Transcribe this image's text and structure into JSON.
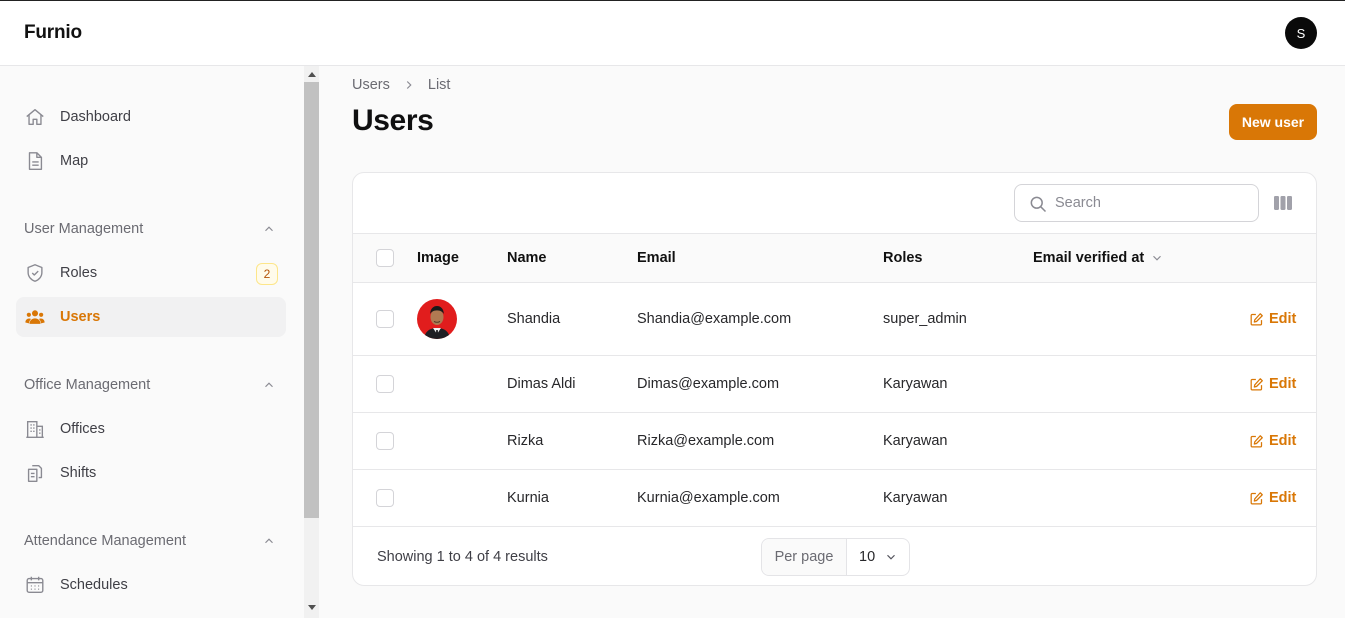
{
  "app": {
    "brand": "Furnio",
    "user_initial": "S"
  },
  "sidebar": {
    "items_top": [
      {
        "label": "Dashboard",
        "icon": "home-icon"
      },
      {
        "label": "Map",
        "icon": "document-icon"
      }
    ],
    "groups": [
      {
        "label": "User Management",
        "items": [
          {
            "label": "Roles",
            "icon": "shield-check-icon",
            "badge": "2"
          },
          {
            "label": "Users",
            "icon": "users-icon",
            "active": true
          }
        ]
      },
      {
        "label": "Office Management",
        "items": [
          {
            "label": "Offices",
            "icon": "building-icon"
          },
          {
            "label": "Shifts",
            "icon": "clipboard-stack-icon"
          }
        ]
      },
      {
        "label": "Attendance Management",
        "items": [
          {
            "label": "Schedules",
            "icon": "calendar-icon"
          }
        ]
      }
    ]
  },
  "breadcrumb": [
    "Users",
    "List"
  ],
  "page": {
    "title": "Users",
    "new_button": "New user"
  },
  "table": {
    "search_placeholder": "Search",
    "columns": [
      "Image",
      "Name",
      "Email",
      "Roles",
      "Email verified at"
    ],
    "rows": [
      {
        "name": "Shandia",
        "email": "Shandia@example.com",
        "role": "super_admin",
        "has_image": true,
        "action": "Edit"
      },
      {
        "name": "Dimas Aldi",
        "email": "Dimas@example.com",
        "role": "Karyawan",
        "has_image": false,
        "action": "Edit"
      },
      {
        "name": "Rizka",
        "email": "Rizka@example.com",
        "role": "Karyawan",
        "has_image": false,
        "action": "Edit"
      },
      {
        "name": "Kurnia",
        "email": "Kurnia@example.com",
        "role": "Karyawan",
        "has_image": false,
        "action": "Edit"
      }
    ],
    "footer": {
      "summary": "Showing 1 to 4 of 4 results",
      "per_page_label": "Per page",
      "per_page_value": "10"
    }
  },
  "colors": {
    "accent": "#d97706",
    "text": "#18181b",
    "muted": "#6b6b72",
    "border": "#e7e7e9"
  }
}
